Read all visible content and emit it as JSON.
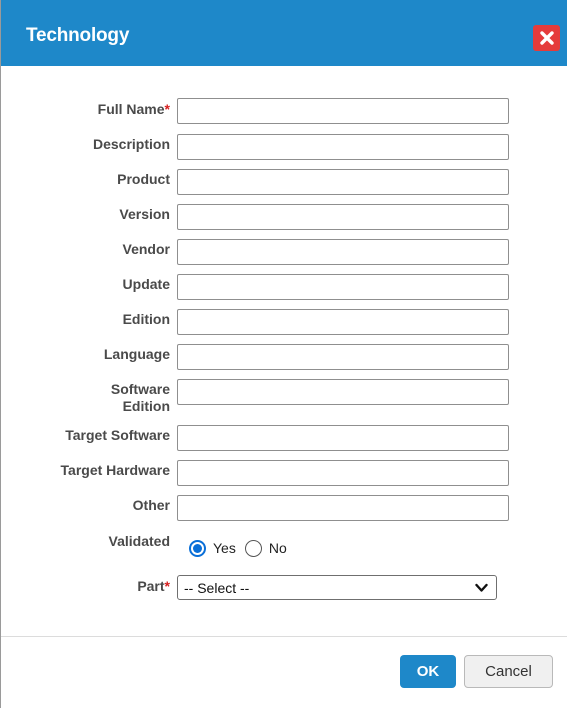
{
  "dialog": {
    "title": "Technology",
    "close_icon": "close-icon"
  },
  "fields": {
    "full_name": {
      "label": "Full Name",
      "required_mark": "*",
      "value": ""
    },
    "description": {
      "label": "Description",
      "value": ""
    },
    "product": {
      "label": "Product",
      "value": ""
    },
    "version": {
      "label": "Version",
      "value": ""
    },
    "vendor": {
      "label": "Vendor",
      "value": ""
    },
    "update": {
      "label": "Update",
      "value": ""
    },
    "edition": {
      "label": "Edition",
      "value": ""
    },
    "language": {
      "label": "Language",
      "value": ""
    },
    "software_edition": {
      "label_line1": "Software",
      "label_line2": "Edition",
      "value": ""
    },
    "target_software": {
      "label": "Target Software",
      "value": ""
    },
    "target_hardware": {
      "label": "Target Hardware",
      "value": ""
    },
    "other": {
      "label": "Other",
      "value": ""
    }
  },
  "validated": {
    "label": "Validated",
    "options": [
      {
        "label": "Yes",
        "selected": true
      },
      {
        "label": "No",
        "selected": false
      }
    ]
  },
  "part": {
    "label": "Part",
    "required_mark": "*",
    "selected": "-- Select --"
  },
  "buttons": {
    "ok": "OK",
    "cancel": "Cancel"
  },
  "colors": {
    "title_bar": "#1e88c9",
    "close_button": "#e53b3b",
    "required": "#d62020",
    "ok_button": "#1e88c9"
  }
}
